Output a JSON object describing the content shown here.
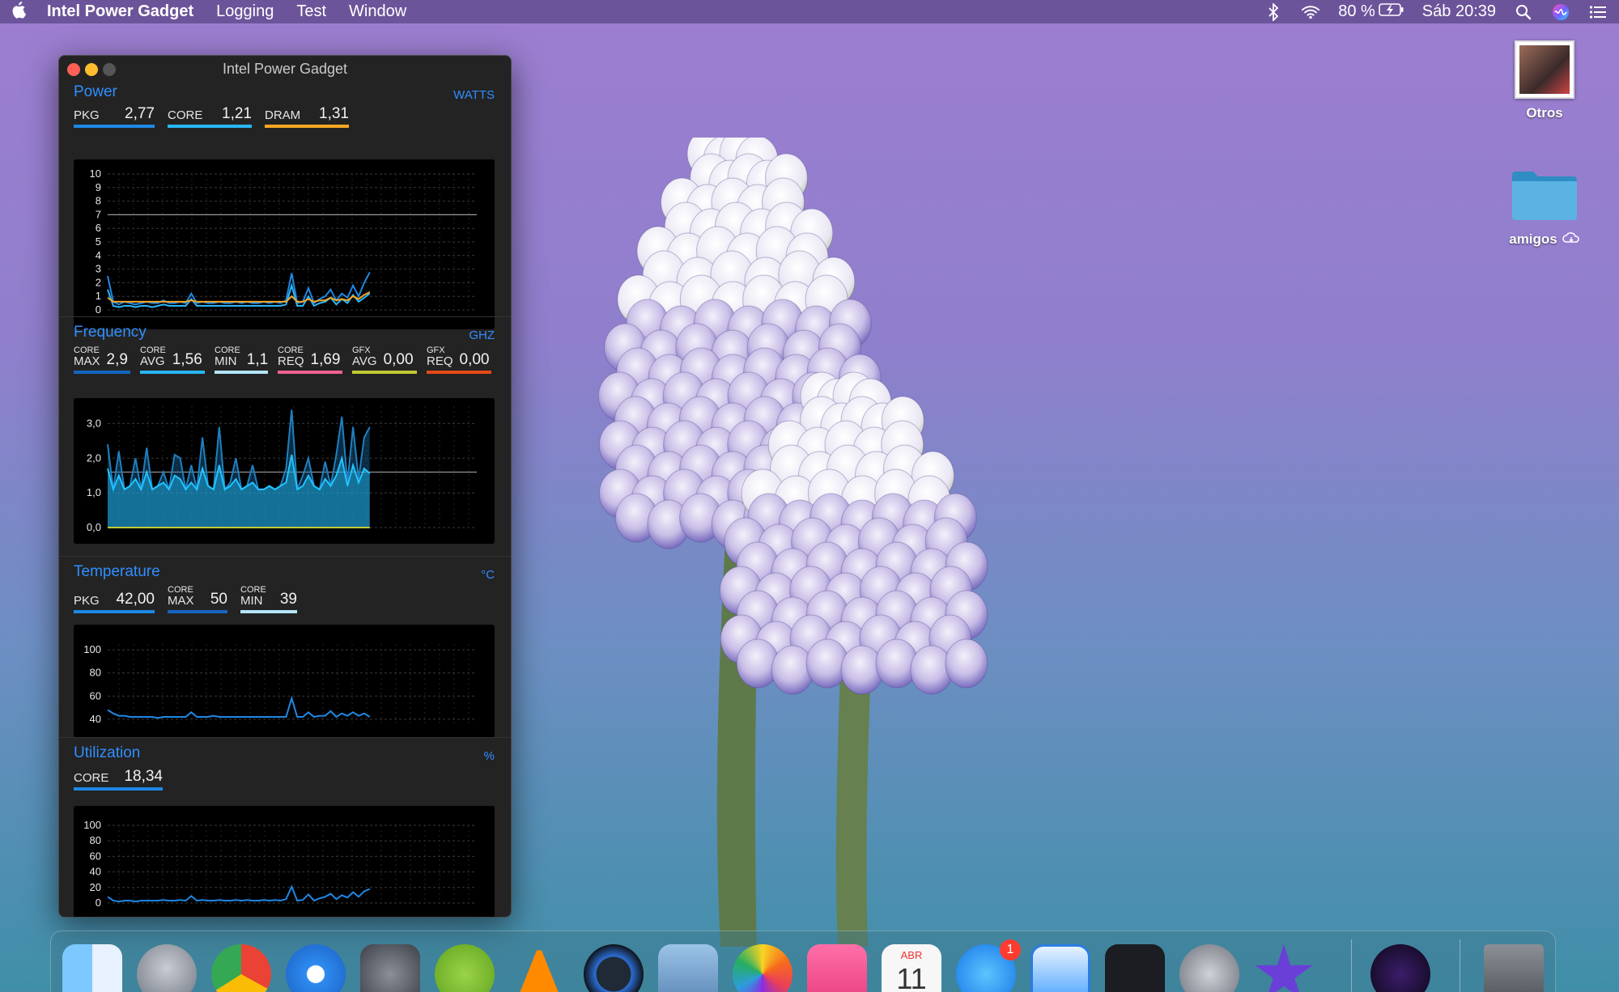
{
  "menubar": {
    "app_name": "Intel Power Gadget",
    "menus": [
      "Logging",
      "Test",
      "Window"
    ],
    "battery": "80 %",
    "clock": "Sáb 20:39"
  },
  "desktop": {
    "items": [
      {
        "label": "Otros",
        "icon": "screenshot-thumbnail-icon"
      },
      {
        "label": "amigos",
        "icon": "folder-icon"
      }
    ]
  },
  "window": {
    "title": "Intel Power Gadget",
    "power": {
      "title": "Power",
      "unit": "WATTS",
      "metrics": [
        {
          "label": "PKG",
          "value": "2,77",
          "color": "#1e88e5"
        },
        {
          "label": "CORE",
          "value": "1,21",
          "color": "#29b6f6"
        },
        {
          "label": "DRAM",
          "value": "1,31",
          "color": "#f5a623"
        }
      ],
      "y_ticks": [
        "10",
        "9",
        "8",
        "7",
        "6",
        "5",
        "4",
        "3",
        "2",
        "1",
        "0"
      ]
    },
    "frequency": {
      "title": "Frequency",
      "unit": "GHZ",
      "metrics": [
        {
          "top": "CORE",
          "bottom": "MAX",
          "value": "2,9",
          "color": "#1565c0"
        },
        {
          "top": "CORE",
          "bottom": "AVG",
          "value": "1,56",
          "color": "#29b6f6"
        },
        {
          "top": "CORE",
          "bottom": "MIN",
          "value": "1,1",
          "color": "#b3e5fc"
        },
        {
          "top": "CORE",
          "bottom": "REQ",
          "value": "1,69",
          "color": "#f06292"
        },
        {
          "top": "GFX",
          "bottom": "AVG",
          "value": "0,00",
          "color": "#c0ca33"
        },
        {
          "top": "GFX",
          "bottom": "REQ",
          "value": "0,00",
          "color": "#e64a19"
        }
      ],
      "y_ticks": [
        "3,0",
        "2,0",
        "1,0",
        "0,0"
      ]
    },
    "temperature": {
      "title": "Temperature",
      "unit": "°C",
      "metrics": [
        {
          "label": "PKG",
          "value": "42,00",
          "color": "#1e88e5"
        },
        {
          "top": "CORE",
          "bottom": "MAX",
          "value": "50",
          "color": "#1565c0"
        },
        {
          "top": "CORE",
          "bottom": "MIN",
          "value": "39",
          "color": "#b3e5fc"
        }
      ],
      "y_ticks": [
        "100",
        "80",
        "60",
        "40"
      ]
    },
    "utilization": {
      "title": "Utilization",
      "unit": "%",
      "metrics": [
        {
          "label": "CORE",
          "value": "18,34",
          "color": "#1e88e5"
        }
      ],
      "y_ticks": [
        "100",
        "80",
        "60",
        "40",
        "20",
        "0"
      ]
    }
  },
  "dock": {
    "calendar_month": "ABR",
    "calendar_day": "11",
    "app_store_badge": "1"
  },
  "chart_data": [
    {
      "type": "line",
      "ylim": [
        0,
        10
      ],
      "series": [
        {
          "name": "PKG",
          "values": [
            2.5,
            0.6,
            0.4,
            0.6,
            0.5,
            0.4,
            0.5,
            0.6,
            0.5,
            0.5,
            0.7,
            0.5,
            0.5,
            0.6,
            0.5,
            1.2,
            0.5,
            0.6,
            0.5,
            0.5,
            0.6,
            0.5,
            0.5,
            0.6,
            0.5,
            0.6,
            0.5,
            0.5,
            0.6,
            0.5,
            0.6,
            0.5,
            0.7,
            2.7,
            0.5,
            0.6,
            1.6,
            0.5,
            0.8,
            1.0,
            1.5,
            0.7,
            1.2,
            0.9,
            1.8,
            1.0,
            2.0,
            2.77
          ]
        },
        {
          "name": "CORE",
          "values": [
            1.5,
            0.3,
            0.2,
            0.3,
            0.3,
            0.2,
            0.3,
            0.3,
            0.2,
            0.3,
            0.4,
            0.3,
            0.3,
            0.3,
            0.3,
            0.8,
            0.3,
            0.3,
            0.3,
            0.3,
            0.3,
            0.3,
            0.3,
            0.3,
            0.3,
            0.3,
            0.3,
            0.3,
            0.3,
            0.3,
            0.3,
            0.3,
            0.4,
            1.8,
            0.3,
            0.3,
            1.0,
            0.3,
            0.5,
            0.6,
            0.9,
            0.4,
            0.8,
            0.5,
            1.1,
            0.6,
            0.9,
            1.21
          ]
        },
        {
          "name": "DRAM",
          "values": [
            0.9,
            0.6,
            0.6,
            0.6,
            0.6,
            0.6,
            0.6,
            0.6,
            0.6,
            0.6,
            0.6,
            0.6,
            0.6,
            0.6,
            0.6,
            0.7,
            0.6,
            0.6,
            0.6,
            0.6,
            0.6,
            0.6,
            0.6,
            0.6,
            0.6,
            0.6,
            0.6,
            0.6,
            0.6,
            0.6,
            0.6,
            0.6,
            0.6,
            1.0,
            0.6,
            0.6,
            0.8,
            0.6,
            0.7,
            0.7,
            0.9,
            0.7,
            0.8,
            0.7,
            1.0,
            0.8,
            1.1,
            1.31
          ]
        }
      ],
      "reference_line": 7
    },
    {
      "type": "area",
      "ylim": [
        0,
        3.5
      ],
      "series": [
        {
          "name": "MAX",
          "values": [
            2.4,
            1.1,
            2.2,
            1.1,
            1.2,
            2.0,
            1.1,
            2.3,
            1.1,
            1.2,
            1.6,
            1.1,
            2.1,
            2.0,
            1.1,
            1.8,
            1.1,
            2.6,
            1.2,
            1.1,
            2.9,
            1.1,
            1.3,
            2.0,
            1.1,
            1.2,
            1.8,
            1.1,
            1.1,
            1.2,
            1.1,
            1.2,
            1.7,
            3.4,
            1.1,
            1.5,
            2.0,
            1.2,
            1.1,
            1.9,
            1.2,
            2.1,
            3.2,
            1.3,
            2.9,
            1.4,
            2.6,
            2.9
          ]
        },
        {
          "name": "AVG",
          "values": [
            1.7,
            1.1,
            1.5,
            1.1,
            1.2,
            1.4,
            1.1,
            1.6,
            1.1,
            1.2,
            1.3,
            1.1,
            1.5,
            1.4,
            1.1,
            1.3,
            1.1,
            1.7,
            1.2,
            1.1,
            1.8,
            1.1,
            1.2,
            1.4,
            1.1,
            1.2,
            1.3,
            1.1,
            1.1,
            1.2,
            1.1,
            1.2,
            1.3,
            2.1,
            1.1,
            1.2,
            1.5,
            1.2,
            1.1,
            1.4,
            1.2,
            1.5,
            2.0,
            1.2,
            1.8,
            1.3,
            1.7,
            1.56
          ]
        },
        {
          "name": "GFX AVG",
          "values": [
            0,
            0,
            0,
            0,
            0,
            0,
            0,
            0,
            0,
            0,
            0,
            0,
            0,
            0,
            0,
            0,
            0,
            0,
            0,
            0,
            0,
            0,
            0,
            0,
            0,
            0,
            0,
            0,
            0,
            0,
            0,
            0,
            0,
            0,
            0,
            0,
            0,
            0,
            0,
            0,
            0,
            0,
            0,
            0,
            0,
            0,
            0,
            0
          ]
        }
      ],
      "reference_line": 1.6
    },
    {
      "type": "line",
      "ylim": [
        35,
        105
      ],
      "series": [
        {
          "name": "PKG",
          "values": [
            48,
            45,
            43,
            43,
            42,
            42,
            42,
            42,
            42,
            41,
            42,
            42,
            42,
            42,
            42,
            46,
            42,
            42,
            42,
            43,
            42,
            42,
            42,
            42,
            42,
            42,
            42,
            42,
            42,
            42,
            42,
            42,
            42,
            58,
            42,
            42,
            46,
            42,
            43,
            43,
            47,
            42,
            45,
            43,
            46,
            43,
            45,
            42
          ]
        }
      ]
    },
    {
      "type": "line",
      "ylim": [
        0,
        100
      ],
      "series": [
        {
          "name": "CORE",
          "values": [
            8,
            3,
            2,
            3,
            3,
            2,
            3,
            3,
            3,
            3,
            4,
            3,
            3,
            4,
            3,
            9,
            3,
            4,
            3,
            3,
            4,
            3,
            3,
            4,
            3,
            4,
            3,
            3,
            4,
            3,
            4,
            3,
            5,
            21,
            3,
            4,
            11,
            3,
            6,
            8,
            12,
            5,
            10,
            7,
            14,
            8,
            15,
            18
          ]
        }
      ]
    }
  ]
}
